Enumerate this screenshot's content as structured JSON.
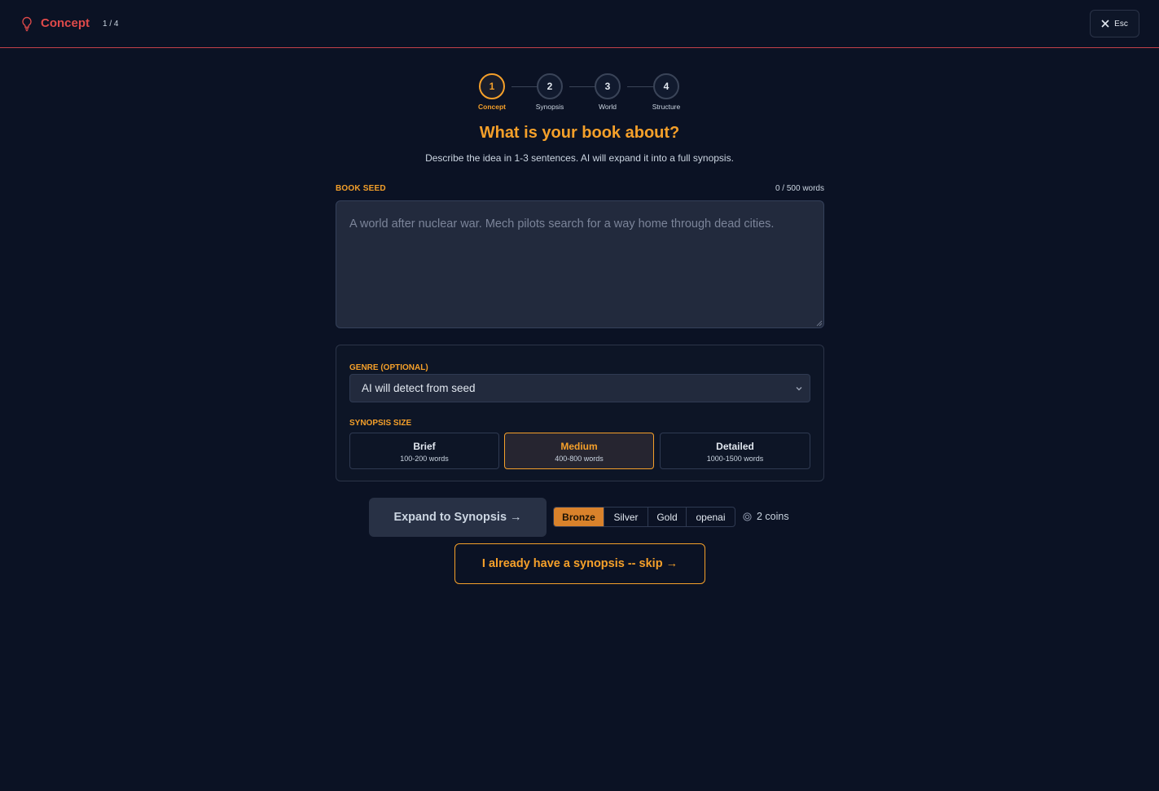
{
  "header": {
    "title": "Concept",
    "step_count": "1 / 4",
    "close_label": "Esc"
  },
  "stepper": {
    "steps": [
      {
        "number": "1",
        "label": "Concept",
        "active": true
      },
      {
        "number": "2",
        "label": "Synopsis",
        "active": false
      },
      {
        "number": "3",
        "label": "World",
        "active": false
      },
      {
        "number": "4",
        "label": "Structure",
        "active": false
      }
    ]
  },
  "main": {
    "heading": "What is your book about?",
    "subheading": "Describe the idea in 1-3 sentences. AI will expand it into a full synopsis.",
    "seed_label": "BOOK SEED",
    "word_count": "0 / 500 words",
    "seed_value": "",
    "seed_placeholder": "A world after nuclear war. Mech pilots search for a way home through dead cities."
  },
  "options": {
    "genre_label": "GENRE (OPTIONAL)",
    "genre_value": "AI will detect from seed",
    "size_label": "SYNOPSIS SIZE",
    "sizes": [
      {
        "title": "Brief",
        "range": "100-200 words",
        "selected": false
      },
      {
        "title": "Medium",
        "range": "400-800 words",
        "selected": true
      },
      {
        "title": "Detailed",
        "range": "1000-1500 words",
        "selected": false
      }
    ]
  },
  "actions": {
    "expand_label": "Expand to Synopsis →",
    "tiers": [
      "Bronze",
      "Silver",
      "Gold",
      "openai"
    ],
    "selected_tier": "Bronze",
    "coins": "2 coins",
    "skip_label": "I already have a synopsis -- skip →"
  },
  "colors": {
    "accent": "#f5a02a",
    "brand_red": "#e04a4a",
    "background": "#0b1224"
  },
  "icons": {
    "header": "lightbulb-icon",
    "close": "close-icon",
    "select": "chevron-down-icon",
    "coins": "coin-icon"
  }
}
